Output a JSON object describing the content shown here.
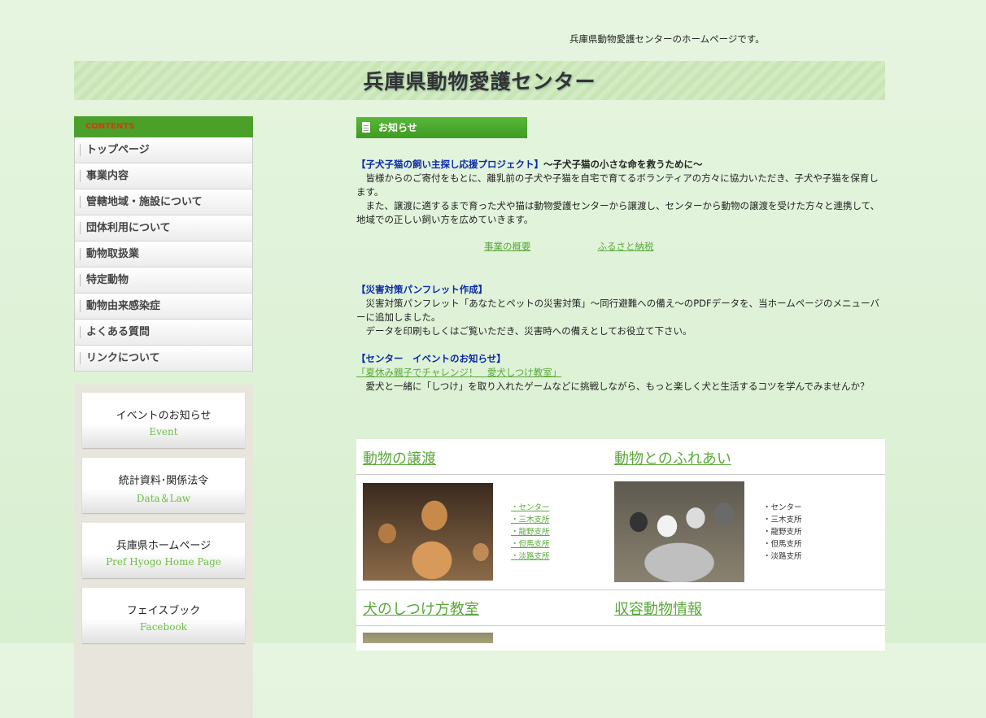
{
  "header": {
    "tagline": "兵庫県動物愛護センターのホームページです。",
    "title": "兵庫県動物愛護センター"
  },
  "sidebar": {
    "contents_label": "CONTENTS",
    "items": [
      {
        "label": "トップページ"
      },
      {
        "label": "事業内容"
      },
      {
        "label": "管轄地域・施設について"
      },
      {
        "label": "団体利用について"
      },
      {
        "label": "動物取扱業"
      },
      {
        "label": "特定動物"
      },
      {
        "label": "動物由来感染症"
      },
      {
        "label": "よくある質問"
      },
      {
        "label": "リンクについて"
      }
    ],
    "banners": [
      {
        "jp": "イベントのお知らせ",
        "en": "Event"
      },
      {
        "jp": "統計資料･関係法令",
        "en": "Data＆Law"
      },
      {
        "jp": "兵庫県ホームページ",
        "en": "Pref Hyogo Home Page"
      },
      {
        "jp": "フェイスブック",
        "en": "Facebook"
      }
    ]
  },
  "notice": {
    "heading": "お知らせ",
    "news1": {
      "title": "【子犬子猫の飼い主探し応援プロジェクト】",
      "subtitle": "～子犬子猫の小さな命を救うために～",
      "p1": "皆様からのご寄付をもとに、離乳前の子犬や子猫を自宅で育てるボランティアの方々に協力いただき、子犬や子猫を保育します。",
      "p2": "また、譲渡に適するまで育った犬や猫は動物愛護センターから譲渡し、センターから動物の譲渡を受けた方々と連携して、地域での正しい飼い方を広めていきます。",
      "link1": "事業の概要",
      "link2": "ふるさと納税"
    },
    "news2": {
      "title": "【災害対策パンフレット作成】",
      "p1": "災害対策パンフレット「あなたとペットの災害対策」～同行避難への備え～のPDFデータを、当ホームページのメニューバーに追加しました。",
      "p2": "データを印刷もしくはご覧いただき、災害時への備えとしてお役立て下さい。"
    },
    "news3": {
      "title": "【センター　イベントのお知らせ】",
      "link": "「夏休み親子でチャレンジ！　愛犬しつけ教室」",
      "p1": "愛犬と一緒に「しつけ」を取り入れたゲームなどに挑戦しながら、もっと楽しく犬と生活するコツを学んでみませんか？"
    }
  },
  "grid": {
    "adoption": {
      "title": "動物の譲渡",
      "branches": [
        "・センター",
        "・三木支所",
        "・龍野支所",
        "・但馬支所",
        "・淡路支所"
      ]
    },
    "interaction": {
      "title": "動物とのふれあい",
      "branches": [
        "・センター",
        "・三木支所",
        "・龍野支所",
        "・但馬支所",
        "・淡路支所"
      ]
    },
    "training": {
      "title": "犬のしつけ方教室"
    },
    "shelter": {
      "title": "収容動物情報"
    }
  }
}
